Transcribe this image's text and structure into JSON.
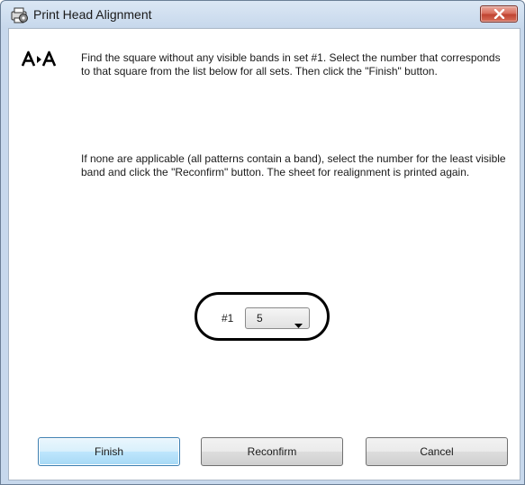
{
  "window": {
    "title": "Print Head Alignment"
  },
  "messages": {
    "instruction": "Find the square without any visible bands in set #1. Select the number that corresponds to that square from the list below for all sets. Then click the \"Finish\" button.",
    "fallback": "If none are applicable (all patterns contain a band), select the number for the least visible band and click the \"Reconfirm\" button. The sheet for realignment is printed again."
  },
  "set_selector": {
    "label": "#1",
    "selected_value": "5"
  },
  "buttons": {
    "finish": "Finish",
    "reconfirm": "Reconfirm",
    "cancel": "Cancel"
  },
  "icons": {
    "app": "printer-gear-icon",
    "logo": "a-to-a-alignment-icon",
    "close": "close-icon",
    "dropdown": "chevron-down-icon"
  },
  "colors": {
    "close_button": "#c04431",
    "default_button": "#bee6fd",
    "highlight_ring": "#000000"
  }
}
